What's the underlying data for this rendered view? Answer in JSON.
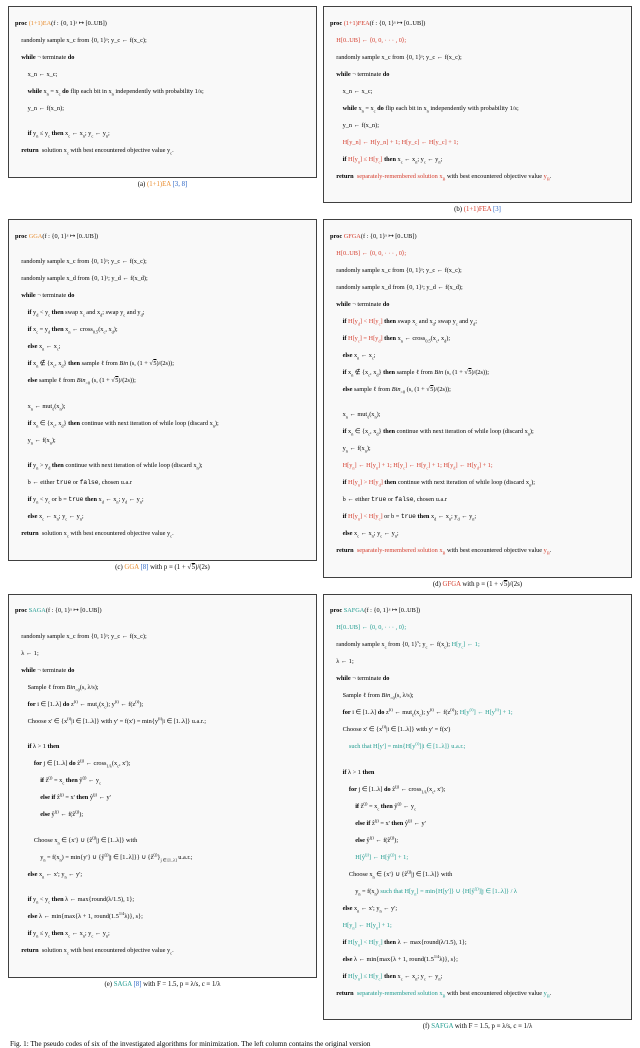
{
  "captions": {
    "a_pre": "(a) ",
    "a_name": "(1+1)EA",
    "a_cites": " [3, 8]",
    "b_pre": "(b) ",
    "b_name": "(1+1)FEA",
    "b_cites": " [3]",
    "c_pre": "(c) ",
    "c_name": "GGA",
    "c_cites": " [8] with p ≡ (1 + √5)/(2s)",
    "d_pre": "(d) ",
    "d_name": "GFGA",
    "d_tail": " with p ≡ (1 + √5)/(2s)",
    "e_pre": "(e) ",
    "e_name": "SAGA",
    "e_cites": " [8] with F = 1.5, p ≡ λ/s, c ≡ 1/λ",
    "f_pre": "(f) ",
    "f_name": "SAFGA",
    "f_tail": " with F = 1.5, p ≡ λ/s, c ≡ 1/λ"
  },
  "footer": "Fig. 1: The pseudo codes of six of the investigated algorithms for minimization. The left column contains the original version",
  "box_a": {
    "l1a": "proc ",
    "l1b": "(1+1)EA",
    "l1c": "(f : {0, 1}ˢ ↦ [0..UB])",
    "l2": "    randomly sample x_c from {0, 1}ˢ; y_c ← f(x_c);",
    "l3": "    while ¬ terminate do",
    "l4": "        x_n ← x_c;",
    "l5": "        while x_n = x_c do flip each bit in x_n independently with probability 1/s;",
    "l6": "        y_n ← f(x_n);",
    "blank": "",
    "l7": "        if y_n ≤ y_c then x_c ← x_n; y_c ← y_n;",
    "l8": "    return  solution x_c with best encountered objective value y_c."
  },
  "box_b": {
    "l1a": "proc ",
    "l1b": "(1+1)FEA",
    "l1c": "(f : {0, 1}ˢ ↦ [0..UB])",
    "l2": "    H[0..UB] ← ⟨0, 0, · · · , 0⟩;",
    "l3": "    randomly sample x_c from {0, 1}ˢ; y_c ← f(x_c);",
    "l4": "    while ¬ terminate do",
    "l5": "        x_n ← x_c;",
    "l6": "        while x_n = x_c do flip each bit in x_n independently with probability 1/s;",
    "l7": "        y_n ← f(x_n);",
    "l8": "        H[y_n] ← H[y_n] + 1; H[y_c] ← H[y_c] + 1;",
    "l9": "        if H[y_n] ≤ H[y_c] then x_c ← x_n; y_c ← y_n;",
    "l10": "    return  separately-remembered solution x_B with best encountered objective value y_B."
  },
  "box_c": {
    "l1a": "proc ",
    "l1b": "GGA",
    "l1c": "(f : {0, 1}ˢ ↦ [0..UB])",
    "blank": "",
    "l2": "    randomly sample x_c from {0, 1}ˢ; y_c ← f(x_c);",
    "l3": "    randomly sample x_d from {0, 1}ˢ; y_d ← f(x_d);",
    "l4": "    while ¬ terminate do",
    "l5": "        if y_d < y_c then swap x_c and x_d; swap y_c and y_d;",
    "l6": "        if x_c = y_d then x_n ← cross_{0.5}(x_c, x_d);",
    "l7": "        else x_n ← x_c;",
    "l8": "        if x_n ∉ {x_c, x_d} then sample ℓ from Bin(s, (1 + √5)/(2s));",
    "l9": "        else sample ℓ from Bin_{>0}(s, (1 + √5)/(2s));",
    "blank2": "",
    "l10": "        x_n ← mut_ℓ(x_n);",
    "l11": "        if x_n ∈ {x_c, x_d} then continue with next iteration of while loop (discard x_n);",
    "l12": "        y_n ← f(x_n);",
    "blank3": "",
    "l13": "        if y_n > y_d then continue with next iteration of while loop (discard x_n);",
    "l14": "        b ← either true or false, chosen u.a.r",
    "l15": "        if y_n < y_c or b = true then x_d ← x_n; y_d ← y_n;",
    "l16": "        else x_c ← x_n; y_c ← y_n;",
    "l17": "    return  solution x_c with best encountered objective value y_c."
  },
  "box_d": {
    "l1a": "proc ",
    "l1b": "GFGA",
    "l1c": "(f : {0, 1}ˢ ↦ [0..UB])",
    "l2": "    H[0..UB] ← ⟨0, 0, · · · , 0⟩;",
    "l3": "    randomly sample x_c from {0, 1}ˢ; y_c ← f(x_c);",
    "l4": "    randomly sample x_d from {0, 1}ˢ; y_d ← f(x_d);",
    "l5": "    while ¬ terminate do",
    "l6a": "        if ",
    "l6r": "H[y_d] < H[y_c]",
    "l6b": " then swap x_c and x_d; swap y_c and y_d;",
    "l7a": "        if ",
    "l7r": "H[y_c] = H[y_d]",
    "l7b": " then x_n ← cross_{0.5}(x_c, x_d);",
    "l8": "        else x_n ← x_c;",
    "l9a": "        if ",
    "l9r": "x_n ∉ {x_c, x_d}",
    "l9b": " then sample ℓ from Bin(s, (1 + √5)/(2s));",
    "l10": "        else sample ℓ from Bin_{>0}(s, (1 + √5)/(2s));",
    "blank": "",
    "l11": "        x_n ← mut_ℓ(x_n);",
    "l12": "        if x_n ∈ {x_c, x_d} then continue with next iteration of while loop (discard x_n);",
    "l13": "        y_n ← f(x_n);",
    "l14": "        H[y_n] ← H[y_n] + 1; H[y_c] ← H[y_c] + 1; H[y_d] ← H[y_d] + 1;",
    "l15a": "        if ",
    "l15r": "H[y_n] > H[y_d]",
    "l15b": " then continue with next iteration of while loop (discard x_n);",
    "l16": "        b ← either true or false, chosen u.a.r",
    "l17a": "        if ",
    "l17r": "H[y_n] < H[y_c]",
    "l17b": " or b = true then x_d ← x_n; y_d ← y_n;",
    "l18": "        else x_c ← x_n; y_c ← y_n;",
    "l19": "    return  separately-remembered solution x_B with best encountered objective value y_B."
  },
  "box_e": {
    "l1a": "proc ",
    "l1b": "SAGA",
    "l1c": "(f : {0, 1}ˢ ↦ [0..UB])",
    "blank0": "",
    "l2": "    randomly sample x_c from {0, 1}ˢ; y_c ← f(x_c);",
    "l3": "    λ ← 1;",
    "l4": "    while ¬ terminate do",
    "l5": "        Sample ℓ from Bin_{>0}(s, λ/s);",
    "l6": "        for i ∈ [1..λ] do z^{(i)} ← mut_ℓ(x_c); y^{(i)} ← f(z^{(i)});",
    "l7": "        Choose x' ∈ {x^{(i)}|i ∈ [1..λ]} with y' = f(x') = min{y^{(i)}|i ∈ [1..λ]} u.a.r.;",
    "blank": "",
    "l8": "        if λ > 1 then",
    "l9": "            for j ∈ [1..λ] do ẑ^{(j)} ← cross_{1/λ}(x_c, x');",
    "l10": "                if ẑ^{(j)} = x_c then ŷ^{(j)} ← y_c",
    "l11": "                else if ẑ^{(j)} = x' then ŷ^{(j)} ← y'",
    "l12": "                else ŷ^{(j)} ← f(ẑ^{(j)});",
    "blank2": "",
    "l13": "            Choose x_n ∈ {x'} ∪ {ẑ^{(j)}|j ∈ [1..λ]} with",
    "l14": "                y_n = f(x_n) = min{y'} ∪ {ŷ^{(j)}|j ∈ [1..λ]}} ∪ {ẑ^{(j)}}_{j ∈ [1..λ]} u.a.r.;",
    "l15": "        else x_n ← x'; y_n ← y';",
    "blank3": "",
    "l16": "        if y_n < y_c then λ ← max{round(λ/1.5), 1};",
    "l17": "        else λ ← min{max{λ + 1, round(1.5^{1/4}λ)}, s};",
    "l18": "        if y_n ≤ y_c then x_c ← x_n; y_c ← y_n;",
    "l19": "    return  solution x_c with best encountered objective value y_c."
  },
  "box_f": {
    "l1a": "proc ",
    "l1b": "SAFGA",
    "l1c": "(f : {0, 1}ˢ ↦ [0..UB])",
    "l2": "    H[0..UB] ← ⟨0, 0, · · · , 0⟩;",
    "l3a": "    randomly sample x_c from {0, 1}ˢ; y_c ← f(x_c); ",
    "l3r": "H[y_c] ← 1",
    ";": ";",
    "l4": "    λ ← 1;",
    "l5": "    while ¬ terminate do",
    "l6": "        Sample ℓ from Bin_{>0}(s, λ/s);",
    "l7a": "        for i ∈ [1..λ] do z^{(i)} ← mut_ℓ(x_c); y^{(i)} ← f(z^{(i)}); ",
    "l7r": "H[y^{(i)}] ← H[y^{(i)}] + 1;",
    "l8": "        Choose x' ∈ {x^{(i)}|i ∈ [1..λ]} with y' = f(x')",
    "l9": "            such that H[y'] = min{H[y^{(i)}]|i ∈ [1..λ]} u.a.r.;",
    "blank": "",
    "l10": "        if λ > 1 then",
    "l11": "            for j ∈ [1..λ] do ẑ^{(j)} ← cross_{1/λ}(x_c, x');",
    "l12": "                if ẑ^{(j)} = x_c then ŷ^{(j)} ← y_c",
    "l13": "                else if ẑ^{(j)} = x' then ŷ^{(j)} ← y'",
    "l14": "                else ŷ^{(j)} ← f(ẑ^{(j)});",
    "l15": "                H[ŷ^{(j)}] ← H[ŷ^{(j)}] + 1;",
    "l16": "            Choose x_n ∈ {x'} ∪ {ẑ^{(j)}|j ∈ [1..λ]} with",
    "l17": "                y_n = f(x_n) such that H[y_n] = min{H[y']} ∪ {H[ŷ^{(j)}]|j ∈ [1..λ]} / λ",
    "l18": "        else x_n ← x'; y_n ← y';",
    "l19": "        H[y_n] ← H[y_n] + 1;",
    "l20a": "        if ",
    "l20r": "H[y_n] < H[y_c]",
    "l20b": " then λ ← max{round(λ/1.5), 1};",
    "l21": "        else λ ← min{max{λ + 1, round(1.5^{1/4}λ)}, s};",
    "l22a": "        if ",
    "l22r": "H[y_n] ≤ H[y_c]",
    "l22b": " then x_c ← x_n; y_c ← y_n;",
    "l23": "    return  separately-remembered solution x_B with best encountered objective value y_B."
  }
}
